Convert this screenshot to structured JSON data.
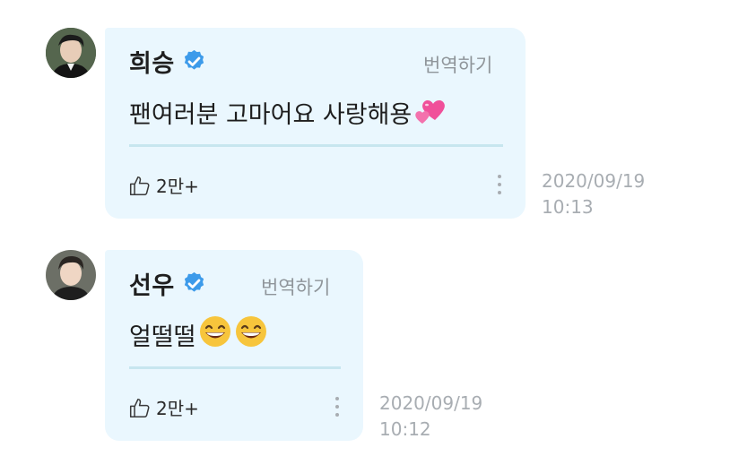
{
  "messages": [
    {
      "author": "희승",
      "verified_icon": "verified-badge-icon",
      "translate_label": "번역하기",
      "text": "팬여러분 고마어요 사랑해용",
      "emoji": "two-hearts-icon",
      "like_count": "2만+",
      "date": "2020/09/19",
      "time": "10:13"
    },
    {
      "author": "선우",
      "verified_icon": "verified-badge-icon",
      "translate_label": "번역하기",
      "text": "얼떨떨",
      "emoji": "grinning-face-icon",
      "like_count": "2만+",
      "date": "2020/09/19",
      "time": "10:12"
    }
  ],
  "colors": {
    "bubble_bg": "#eaf7fe",
    "verified": "#3d9bea",
    "divider": "#c7e6ef",
    "timestamp": "#a8adb2"
  }
}
